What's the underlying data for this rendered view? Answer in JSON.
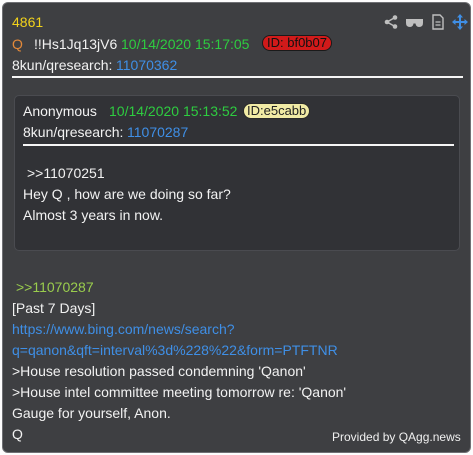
{
  "post": {
    "number": "4861",
    "author": "Q",
    "tripcode": "!!Hs1Jq13jV6",
    "timestamp": "10/14/2020 15:17:05",
    "id_label": "ID: bf0b07",
    "board": "8kun/qresearch:",
    "post_id": "11070362"
  },
  "quoted": {
    "author": "Anonymous",
    "timestamp": "10/14/2020 15:13:52",
    "id_label": "ID:e5cabb",
    "board": "8kun/qresearch:",
    "post_id": "11070287",
    "lines": [
      ">>11070251",
      "Hey Q , how are we doing so far?",
      "Almost 3 years in now."
    ]
  },
  "body": {
    "reply_link": ">>11070287",
    "line1": "[Past 7 Days]",
    "url_line1": "https://www.bing.com/news/search?",
    "url_line2": "q=qanon&qft=interval%3d%228%22&form=PTFTNR",
    "line2": ">House resolution passed condemning 'Qanon'",
    "line3": ">House intel committee meeting tomorrow re: 'Qanon'",
    "line4": "Gauge for yourself, Anon.",
    "line5": "Q"
  },
  "footer": "Provided by QAgg.news",
  "icons": [
    "share-icon",
    "glasses-icon",
    "document-icon",
    "move-icon"
  ],
  "colors": {
    "background": "#3e3f42",
    "accent_blue": "#3f8fe6",
    "timestamp_green": "#2ecc40",
    "number_yellow": "#f2d21b",
    "id_red": "#d11a1a"
  }
}
